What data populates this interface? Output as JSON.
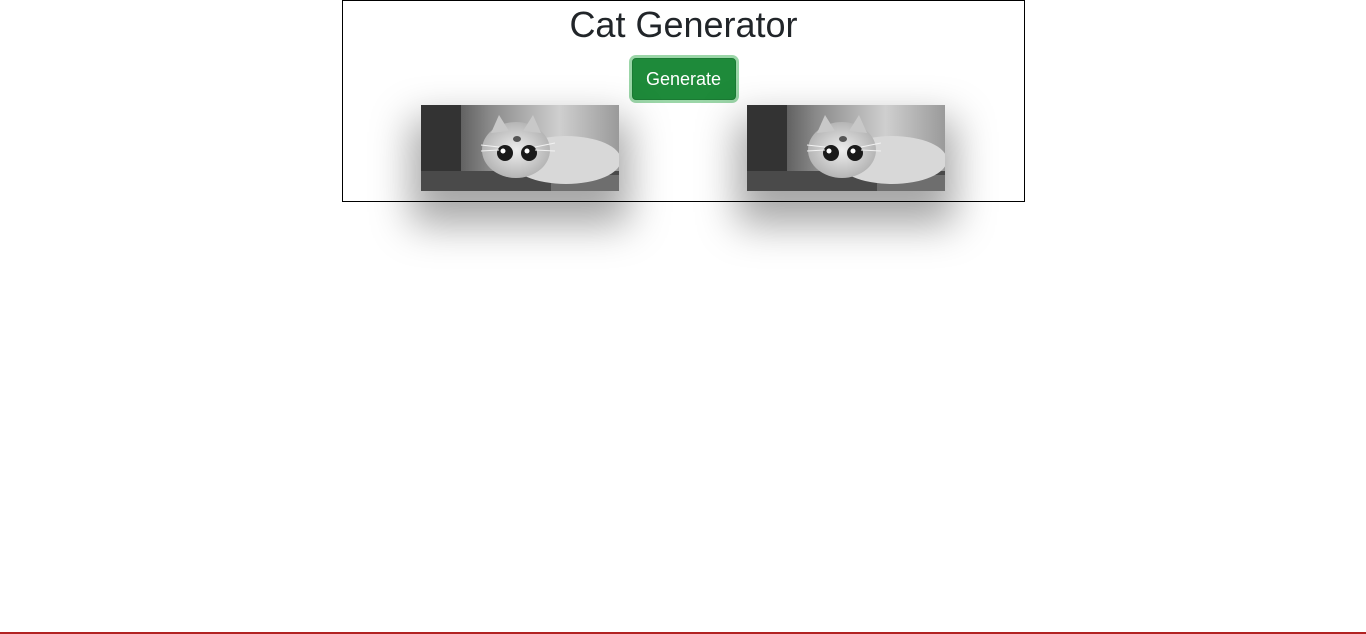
{
  "page": {
    "title": "Cat Generator"
  },
  "controls": {
    "generate_label": "Generate"
  },
  "colors": {
    "button_bg": "#1e8a3a",
    "button_text": "#ffffff",
    "title_text": "#212529",
    "card_border": "#000000"
  },
  "images": [
    {
      "description_icon": "cat-photo-icon"
    },
    {
      "description_icon": "cat-photo-icon"
    }
  ]
}
